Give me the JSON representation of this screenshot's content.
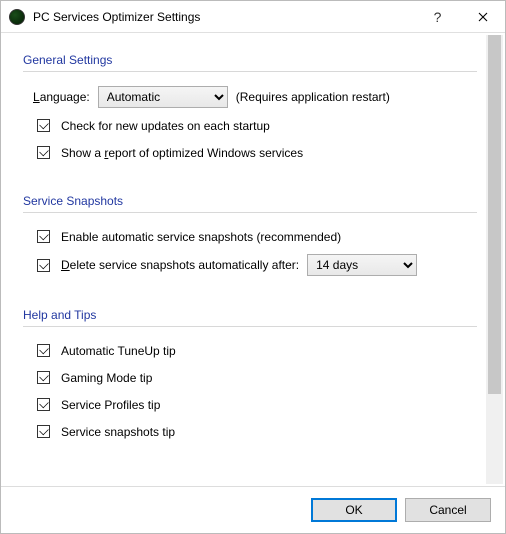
{
  "window": {
    "title": "PC Services Optimizer Settings"
  },
  "sections": {
    "general": {
      "title": "General Settings",
      "language_label": "Language:",
      "language_value": "Automatic",
      "language_note": "(Requires application restart)",
      "check_updates": "Check for new updates on each startup",
      "show_report": "Show a report of optimized Windows services"
    },
    "snapshots": {
      "title": "Service Snapshots",
      "enable": "Enable automatic service snapshots (recommended)",
      "delete_label": "Delete service snapshots automatically after:",
      "delete_value": "14 days"
    },
    "help": {
      "title": "Help and Tips",
      "tip1": "Automatic TuneUp tip",
      "tip2": "Gaming Mode tip",
      "tip3": "Service Profiles tip",
      "tip4": "Service snapshots tip"
    }
  },
  "footer": {
    "ok": "OK",
    "cancel": "Cancel"
  }
}
